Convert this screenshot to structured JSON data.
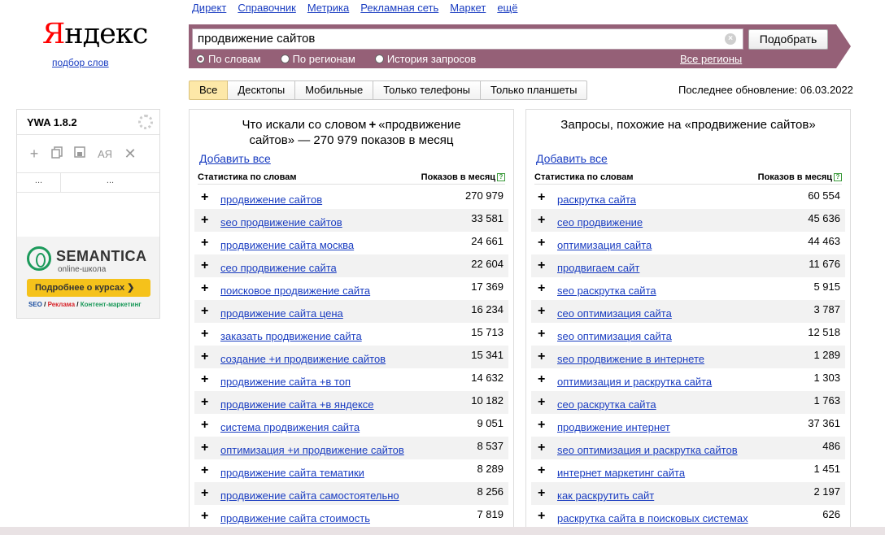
{
  "logo": {
    "text_first": "Я",
    "text_rest": "ндекс",
    "subtitle": "подбор слов"
  },
  "topnav": [
    "Директ",
    "Справочник",
    "Метрика",
    "Рекламная сеть",
    "Маркет",
    "ещё"
  ],
  "search": {
    "query": "продвижение сайтов",
    "clear": "×",
    "submit": "Подобрать"
  },
  "radios": [
    {
      "label": "По словам",
      "checked": true
    },
    {
      "label": "По регионам",
      "checked": false
    },
    {
      "label": "История запросов",
      "checked": false
    }
  ],
  "regions_link": "Все регионы",
  "tabs": [
    "Все",
    "Десктопы",
    "Мобильные",
    "Только телефоны",
    "Только планшеты"
  ],
  "active_tab": "Все",
  "update": "Последнее обновление: 06.03.2022",
  "left": {
    "title_a": "Что искали со словом",
    "title_plus": "+",
    "title_b": "«продвижение сайтов» — 270 979 показов в месяц",
    "add_all": "Добавить все",
    "col_kw": "Статистика по словам",
    "col_count": "Показов в месяц",
    "help": "?",
    "rows": [
      {
        "kw": "продвижение сайтов",
        "count": "270 979"
      },
      {
        "kw": "seo продвижение сайтов",
        "count": "33 581"
      },
      {
        "kw": "продвижение сайта москва",
        "count": "24 661"
      },
      {
        "kw": "сео продвижение сайта",
        "count": "22 604"
      },
      {
        "kw": "поисковое продвижение сайта",
        "count": "17 369"
      },
      {
        "kw": "продвижение сайта цена",
        "count": "16 234"
      },
      {
        "kw": "заказать продвижение сайта",
        "count": "15 713"
      },
      {
        "kw": "создание +и продвижение сайтов",
        "count": "15 341"
      },
      {
        "kw": "продвижение сайта +в топ",
        "count": "14 632"
      },
      {
        "kw": "продвижение сайта +в яндексе",
        "count": "10 182"
      },
      {
        "kw": "система продвижения сайта",
        "count": "9 051"
      },
      {
        "kw": "оптимизация +и продвижение сайтов",
        "count": "8 537"
      },
      {
        "kw": "продвижение сайта тематики",
        "count": "8 289"
      },
      {
        "kw": "продвижение сайта самостоятельно",
        "count": "8 256"
      },
      {
        "kw": "продвижение сайта стоимость",
        "count": "7 819"
      }
    ]
  },
  "right": {
    "title": "Запросы, похожие на «продвижение сайтов»",
    "add_all": "Добавить все",
    "col_kw": "Статистика по словам",
    "col_count": "Показов в месяц",
    "help": "?",
    "rows": [
      {
        "kw": "раскрутка сайта",
        "count": "60 554"
      },
      {
        "kw": "сео продвижение",
        "count": "45 636"
      },
      {
        "kw": "оптимизация сайта",
        "count": "44 463"
      },
      {
        "kw": "продвигаем сайт",
        "count": "11 676"
      },
      {
        "kw": "seo раскрутка сайта",
        "count": "5 915"
      },
      {
        "kw": "сео оптимизация сайта",
        "count": "3 787"
      },
      {
        "kw": "seo оптимизация сайта",
        "count": "12 518"
      },
      {
        "kw": "seo продвижение в интернете",
        "count": "1 289"
      },
      {
        "kw": "оптимизация и раскрутка сайта",
        "count": "1 303"
      },
      {
        "kw": "сео раскрутка сайта",
        "count": "1 763"
      },
      {
        "kw": "продвижение интернет",
        "count": "37 361"
      },
      {
        "kw": "seo оптимизация и раскрутка сайтов",
        "count": "486"
      },
      {
        "kw": "интернет маркетинг сайта",
        "count": "1 451"
      },
      {
        "kw": "как раскрутить сайт",
        "count": "2 197"
      },
      {
        "kw": "раскрутка сайта в поисковых системах",
        "count": "626"
      }
    ]
  },
  "ywa": {
    "title": "YWA 1.8.2",
    "tool_add": "+",
    "tool_ab": "АЯ",
    "tool_close": "✕",
    "cell_a": "...",
    "cell_b": "...",
    "ad_title": "SEMANTICA",
    "ad_sub": "online-школа",
    "ad_button": "Подробнее о курсах ❯",
    "ad_tag1": "SEO",
    "ad_tag2": "Реклама",
    "ad_tag3": "Контент-маркетинг",
    "ad_sep": " / "
  },
  "colors": {
    "brand_bar": "#956077",
    "link": "#1a3dc1",
    "active_tab": "#fde8a8",
    "ad_button": "#f5c21b",
    "ad_green": "#1c9a5b"
  }
}
